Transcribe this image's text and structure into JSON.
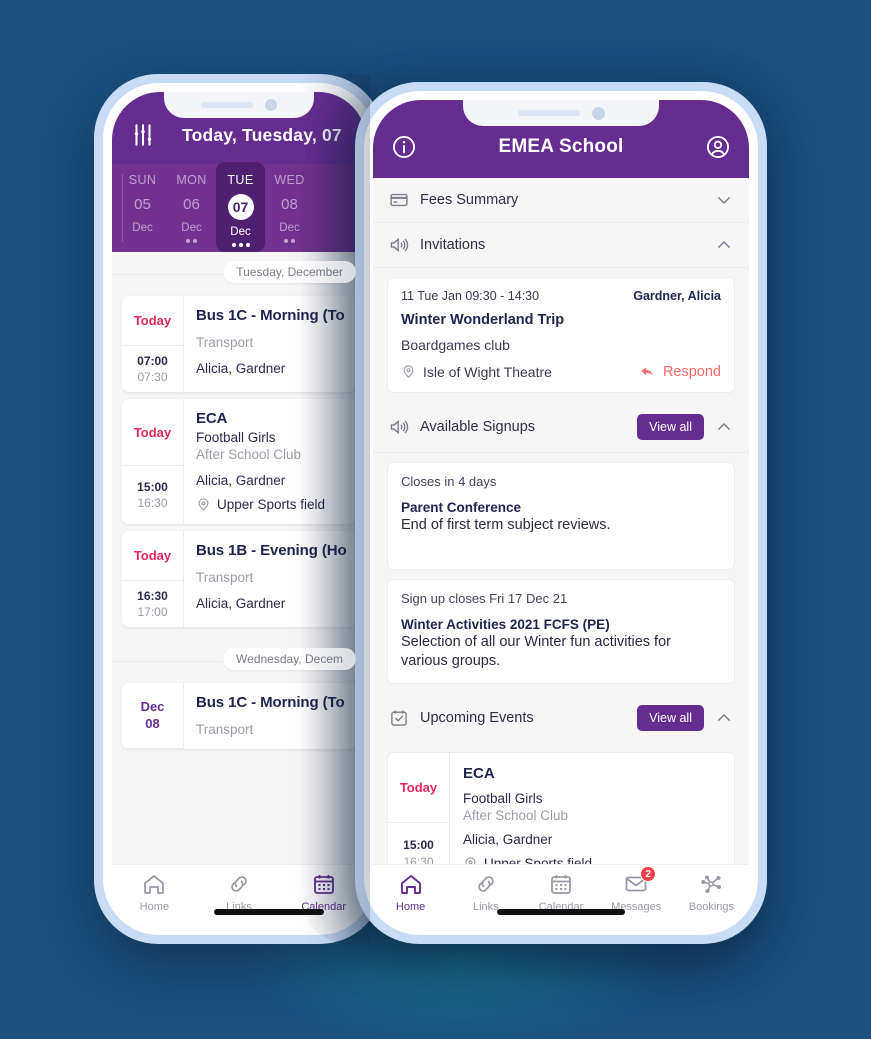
{
  "theme": {
    "background": "#1a4f7e",
    "brand_purple": "#662d91",
    "accent_pink": "#e8265c",
    "respond_red": "#f96a6a",
    "badge_red": "#f4404a"
  },
  "left_phone": {
    "header": {
      "filter_icon": "sliders-icon",
      "title": "Today, Tuesday, 07"
    },
    "date_strip": [
      {
        "dow": "SUN",
        "num": "05",
        "mon": "Dec",
        "dots": 0,
        "active": false
      },
      {
        "dow": "MON",
        "num": "06",
        "mon": "Dec",
        "dots": 2,
        "active": false
      },
      {
        "dow": "TUE",
        "num": "07",
        "mon": "Dec",
        "dots": 3,
        "active": true
      },
      {
        "dow": "WED",
        "num": "08",
        "mon": "Dec",
        "dots": 2,
        "active": false
      }
    ],
    "groups": [
      {
        "chip": "Tuesday, December",
        "events": [
          {
            "badge": "Today",
            "badge_style": "today",
            "start": "07:00",
            "end": "07:30",
            "title": "Bus 1C - Morning (To",
            "subtitle": "Transport",
            "people": "Alicia, Gardner",
            "location": ""
          },
          {
            "badge": "Today",
            "badge_style": "today",
            "start": "15:00",
            "end": "16:30",
            "title": "ECA",
            "line1": "Football Girls",
            "line2": "After School Club",
            "people": "Alicia, Gardner",
            "location": "Upper Sports field"
          },
          {
            "badge": "Today",
            "badge_style": "today",
            "start": "16:30",
            "end": "17:00",
            "title": "Bus 1B - Evening (Ho",
            "subtitle": "Transport",
            "people": "Alicia, Gardner",
            "location": ""
          }
        ]
      },
      {
        "chip": "Wednesday, Decem",
        "events": [
          {
            "badge": "Dec 08",
            "badge_line1": "Dec",
            "badge_line2": "08",
            "badge_style": "future",
            "start": "",
            "end": "",
            "title": "Bus 1C - Morning (To",
            "subtitle": "Transport",
            "people": "",
            "location": ""
          }
        ]
      }
    ],
    "tabbar": [
      {
        "label": "Home",
        "icon": "home-icon",
        "active": false,
        "badge": ""
      },
      {
        "label": "Links",
        "icon": "link-icon",
        "active": false,
        "badge": ""
      },
      {
        "label": "Calendar",
        "icon": "calendar-icon",
        "active": true,
        "badge": ""
      }
    ]
  },
  "right_phone": {
    "header": {
      "info_icon": "info-icon",
      "title": "EMEA School",
      "account_icon": "account-icon"
    },
    "sections": {
      "fees": {
        "icon": "card-icon",
        "title": "Fees Summary",
        "chevron": "chevron-down-icon"
      },
      "invitations": {
        "icon": "announce-icon",
        "title": "Invitations",
        "chevron": "chevron-up-icon",
        "items": [
          {
            "date": "11 Tue Jan 09:30 - 14:30",
            "who": "Gardner, Alicia",
            "title": "Winter Wonderland Trip",
            "club": "Boardgames club",
            "location": "Isle of Wight Theatre",
            "action": "Respond",
            "action_icon": "reply-icon"
          }
        ]
      },
      "signups": {
        "icon": "announce-icon",
        "title": "Available Signups",
        "view_all": "View all",
        "chevron": "chevron-up-icon",
        "items": [
          {
            "meta": "Closes in 4 days",
            "title": "Parent Conference",
            "desc": "End of first term subject reviews."
          },
          {
            "meta": "Sign up closes  Fri 17 Dec 21",
            "title": "Winter Activities 2021 FCFS (PE)",
            "desc": "Selection of all our Winter fun activities for various groups."
          }
        ]
      },
      "upcoming": {
        "icon": "calendar-check-icon",
        "title": "Upcoming Events",
        "view_all": "View all",
        "chevron": "chevron-up-icon",
        "items": [
          {
            "badge": "Today",
            "start": "15:00",
            "end": "16:30",
            "title": "ECA",
            "line1": "Football Girls",
            "line2": "After School Club",
            "people": "Alicia, Gardner",
            "location": "Upper Sports field"
          }
        ]
      }
    },
    "tabbar": [
      {
        "label": "Home",
        "icon": "home-icon",
        "active": true,
        "badge": ""
      },
      {
        "label": "Links",
        "icon": "link-icon",
        "active": false,
        "badge": ""
      },
      {
        "label": "Calendar",
        "icon": "calendar-icon",
        "active": false,
        "badge": ""
      },
      {
        "label": "Messages",
        "icon": "mail-icon",
        "active": false,
        "badge": "2"
      },
      {
        "label": "Bookings",
        "icon": "bookings-icon",
        "active": false,
        "badge": ""
      }
    ]
  }
}
